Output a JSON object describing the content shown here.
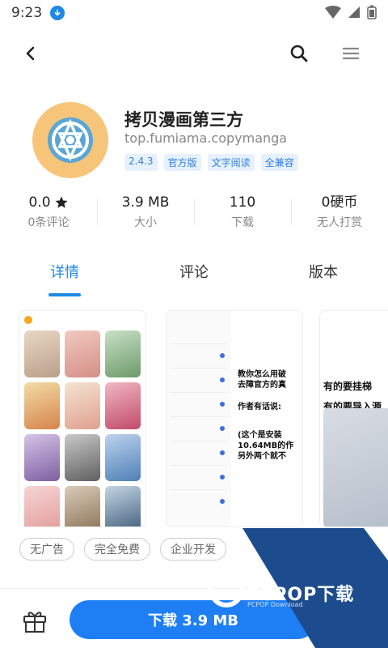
{
  "status_bar": {
    "time": "9:23"
  },
  "app": {
    "title": "拷贝漫画第三方",
    "package": "top.fumiama.copymanga",
    "tags": [
      "2.4.3",
      "官方版",
      "文字阅读",
      "全兼容"
    ]
  },
  "stats": [
    {
      "value": "0.0",
      "label": "0条评论",
      "has_star": true
    },
    {
      "value": "3.9 MB",
      "label": "大小"
    },
    {
      "value": "110",
      "label": "下载"
    },
    {
      "value": "0硬币",
      "label": "无人打赏"
    }
  ],
  "tabs": [
    {
      "label": "详情",
      "active": true
    },
    {
      "label": "评论",
      "active": false
    },
    {
      "label": "版本",
      "active": false
    }
  ],
  "screenshots": {
    "shot2_lines": [
      "教你怎么用破",
      "去障官方的真",
      "作者有话说:",
      "(这个是安装",
      "10.64MB的作",
      "另外两个就不"
    ],
    "shot3_lines": [
      "有的要挂梯",
      "有的要导入源"
    ]
  },
  "feature_chips": [
    "无广告",
    "完全免费",
    "企业开发"
  ],
  "download_button": "下载 3.9 MB",
  "watermark": {
    "text": "PCPOP下载",
    "sub": "PCPOP Download"
  },
  "colors": {
    "accent": "#1e88e5",
    "download": "#1e7ff5",
    "watermark": "#1d4c8e"
  }
}
